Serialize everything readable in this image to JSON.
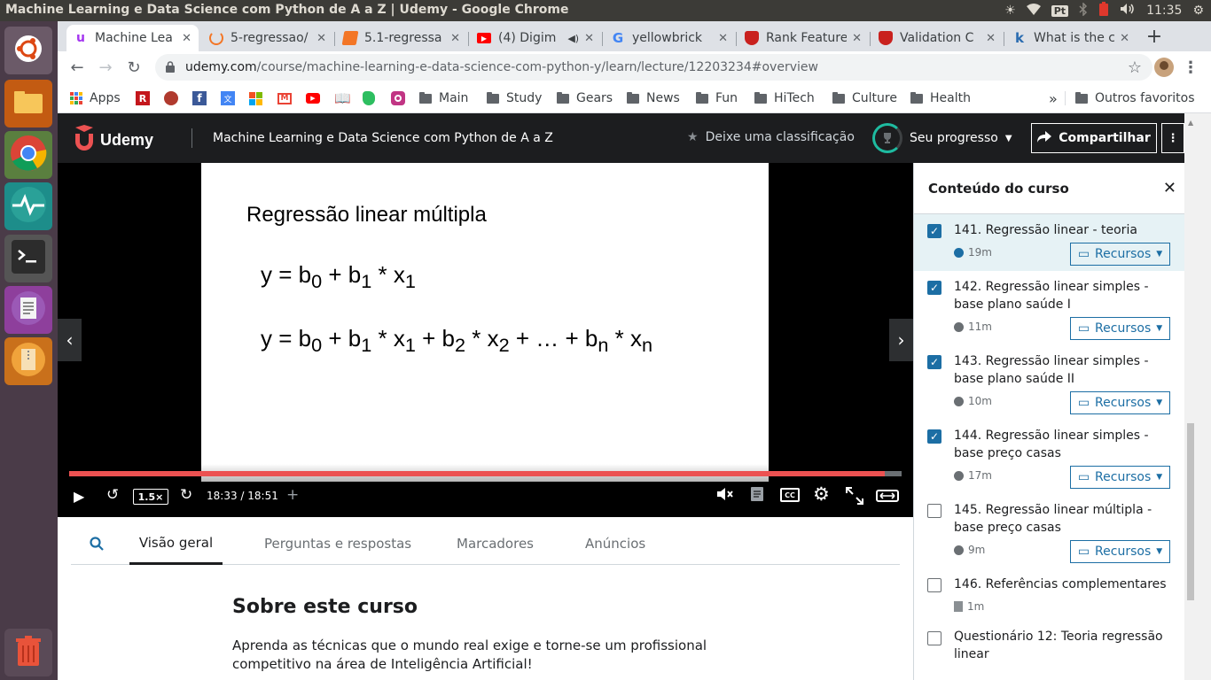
{
  "window": {
    "title": "Machine Learning e Data Science com Python de A a Z | Udemy - Google Chrome"
  },
  "system": {
    "time": "11:35",
    "lang": "Pt"
  },
  "tabs": [
    {
      "label": "Machine Lea",
      "active": true,
      "color": "#a435f0"
    },
    {
      "label": "5-regressao/",
      "active": false,
      "color": "#f37626"
    },
    {
      "label": "5.1-regressa",
      "active": false,
      "color": "#f37626"
    },
    {
      "label": "(4) Digim",
      "active": false,
      "color": "#ff0000"
    },
    {
      "label": "yellowbrick",
      "active": false,
      "color": "#4285f4"
    },
    {
      "label": "Rank Feature",
      "active": false,
      "color": "#c9211e"
    },
    {
      "label": "Validation C",
      "active": false,
      "color": "#c9211e"
    },
    {
      "label": "What is the c",
      "active": false,
      "color": "#2b6cb0"
    }
  ],
  "address": {
    "host": "udemy.com",
    "path": "/course/machine-learning-e-data-science-com-python-y/learn/lecture/12203234#overview"
  },
  "bookmarks": {
    "apps": "Apps",
    "folders": [
      "Main",
      "Study",
      "Gears",
      "News",
      "Fun",
      "HiTech",
      "Culture",
      "Health"
    ],
    "more": "»",
    "others": "Outros favoritos"
  },
  "header": {
    "brand": "Udemy",
    "course_title": "Machine Learning e Data Science com Python de A a Z",
    "rate": "Deixe uma classificação",
    "progress": "Seu progresso",
    "share": "Compartilhar"
  },
  "slide": {
    "title": "Regressão linear múltipla",
    "eq1": {
      "y": "y = b",
      "s0": "0",
      "p1": " + b",
      "s1": "1",
      "p2": " * x",
      "s2": "1"
    },
    "eq2": {
      "a": "y = b",
      "s0": "0",
      "b": " + b",
      "s1": "1",
      "c": " * x",
      "s2": "1",
      "d": " + b",
      "s3": "2",
      "e": " * x",
      "s4": "2",
      "f": " + … + b",
      "s5": "n",
      "g": " * x",
      "s6": "n"
    }
  },
  "player": {
    "speed": "1.5×",
    "time": "18:33 / 18:51",
    "progress": 0.98,
    "cc": "CC"
  },
  "lower_tabs": [
    "Visão geral",
    "Perguntas e respostas",
    "Marcadores",
    "Anúncios"
  ],
  "about": {
    "heading": "Sobre este curso",
    "text1": "Aprenda as técnicas que o mundo real exige e torne-se um profissional",
    "text2": "competitivo na área de Inteligência Artificial!"
  },
  "sidebar": {
    "title": "Conteúdo do curso",
    "resources": "Recursos",
    "items": [
      {
        "title": "141. Regressão linear - teoria",
        "duration": "19m",
        "checked": true
      },
      {
        "title": "142. Regressão linear simples - base plano saúde I",
        "duration": "11m",
        "checked": true
      },
      {
        "title": "143. Regressão linear simples - base plano saúde II",
        "duration": "10m",
        "checked": true
      },
      {
        "title": "144. Regressão linear simples - base preço casas",
        "duration": "17m",
        "checked": true
      },
      {
        "title": "145. Regressão linear múltipla - base preço casas",
        "duration": "9m",
        "checked": false
      },
      {
        "title": "146. Referências complementares",
        "duration": "1m",
        "checked": false
      },
      {
        "title": "Questionário 12: Teoria regressão linear",
        "duration": "",
        "checked": false
      }
    ]
  }
}
